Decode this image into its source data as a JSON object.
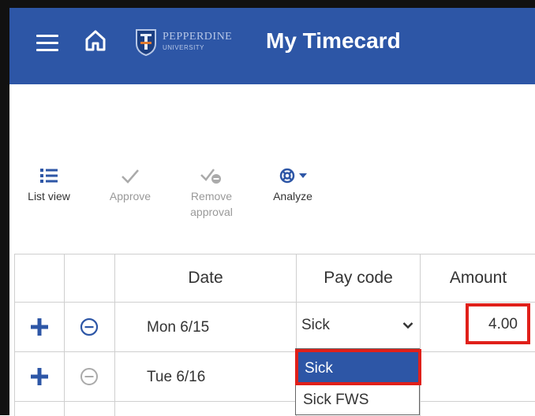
{
  "header": {
    "title": "My Timecard",
    "logo": {
      "name": "PEPPERDINE",
      "subtitle": "UNIVERSITY"
    },
    "colors": {
      "bar": "#2d56a6",
      "text": "#ffffff"
    }
  },
  "toolbar": {
    "items": [
      {
        "label": "List view",
        "icon": "list-icon",
        "enabled": true
      },
      {
        "label": "Approve",
        "icon": "check-icon",
        "enabled": false
      },
      {
        "label_line1": "Remove",
        "label_line2": "approval",
        "icon": "remove-approval-icon",
        "enabled": false
      },
      {
        "label": "Analyze",
        "icon": "analyze-icon",
        "enabled": true,
        "has_dropdown": true
      }
    ]
  },
  "grid": {
    "columns": [
      "",
      "",
      "Date",
      "Pay code",
      "Amount"
    ],
    "rows": [
      {
        "date": "Mon 6/15",
        "pay_code": "Sick",
        "amount": "4.00",
        "remove_enabled": true
      },
      {
        "date": "Tue 6/16",
        "pay_code": "",
        "amount": "",
        "remove_enabled": false
      }
    ]
  },
  "paycode_dropdown": {
    "options": [
      "Sick",
      "Sick FWS"
    ],
    "selected": "Sick"
  },
  "colors": {
    "accent": "#2d56a6",
    "highlight_border": "#e0201a",
    "disabled": "#999999"
  }
}
